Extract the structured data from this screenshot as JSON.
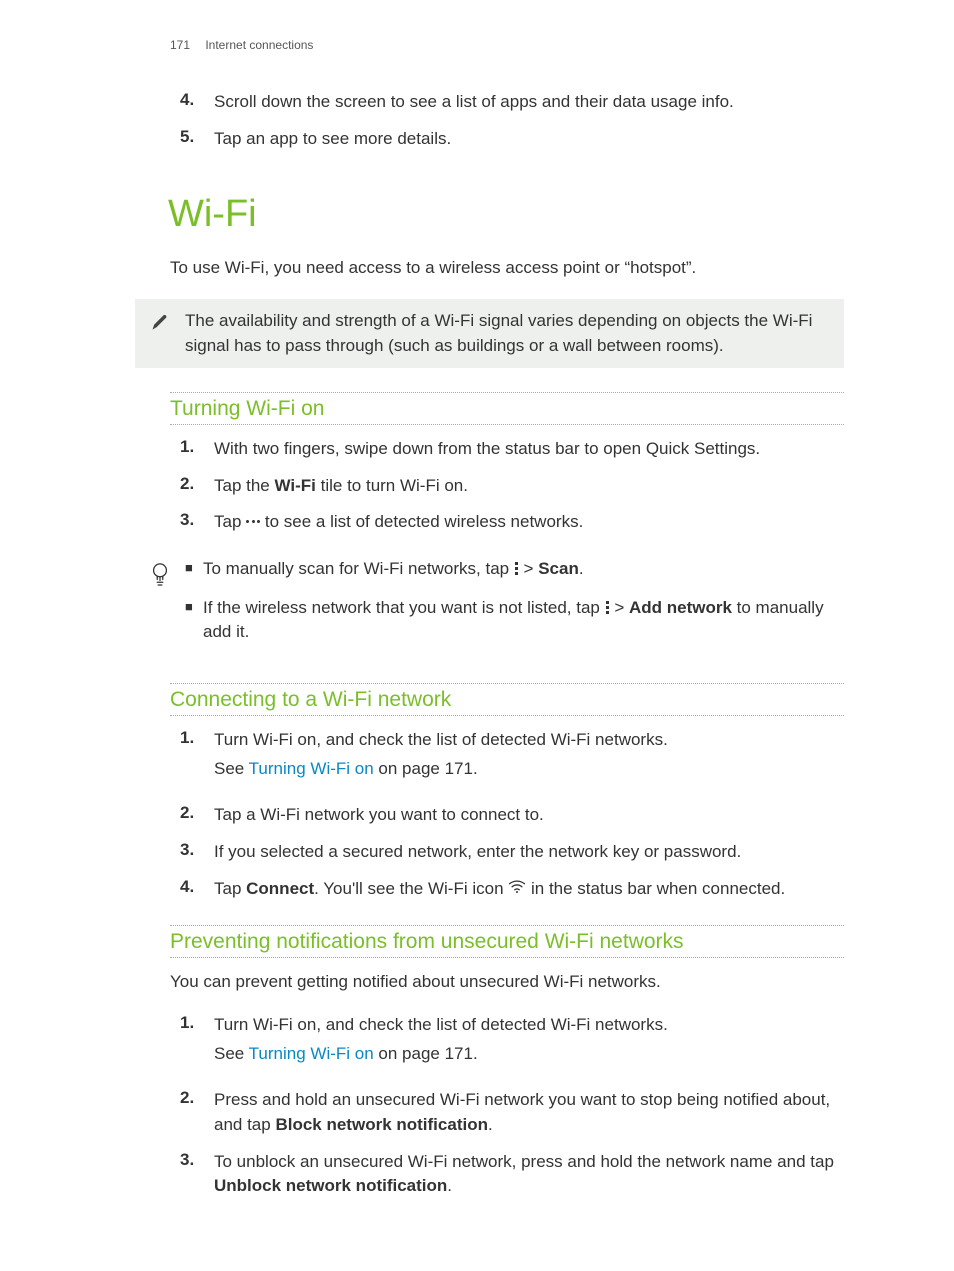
{
  "header": {
    "page": "171",
    "section": "Internet connections"
  },
  "intro_steps": [
    {
      "n": "4.",
      "t": "Scroll down the screen to see a list of apps and their data usage info."
    },
    {
      "n": "5.",
      "t": "Tap an app to see more details."
    }
  ],
  "h1": "Wi-Fi",
  "lead": "To use Wi-Fi, you need access to a wireless access point or “hotspot”.",
  "note1": "The availability and strength of a Wi-Fi signal varies depending on objects the Wi-Fi signal has to pass through (such as buildings or a wall between rooms).",
  "sec1": {
    "title": "Turning Wi-Fi on",
    "steps": {
      "s1": {
        "n": "1.",
        "t": "With two fingers, swipe down from the status bar to open Quick Settings."
      },
      "s2": {
        "n": "2.",
        "pre": "Tap the ",
        "bold": "Wi-Fi",
        "post": " tile to turn Wi-Fi on."
      },
      "s3": {
        "n": "3.",
        "pre": "Tap ",
        "post": " to see a list of detected wireless networks."
      }
    }
  },
  "tip1": {
    "b1": {
      "pre": "To manually scan for Wi-Fi networks, tap ",
      "mid": " > ",
      "bold": "Scan",
      "post": "."
    },
    "b2": {
      "pre": "If the wireless network that you want is not listed, tap ",
      "mid": " > ",
      "bold": "Add network",
      "post": " to manually add it."
    }
  },
  "sec2": {
    "title": "Connecting to a Wi-Fi network",
    "s1": {
      "n": "1.",
      "t": "Turn Wi-Fi on, and check the list of detected Wi-Fi networks.",
      "sub_pre": "See ",
      "sub_link": "Turning Wi-Fi on",
      "sub_post": " on page 171."
    },
    "s2": {
      "n": "2.",
      "t": "Tap a Wi-Fi network you want to connect to."
    },
    "s3": {
      "n": "3.",
      "t": "If you selected a secured network, enter the network key or password."
    },
    "s4": {
      "n": "4.",
      "pre": "Tap ",
      "bold": "Connect",
      "mid": ". You'll see the Wi-Fi icon ",
      "post": " in the status bar when connected."
    }
  },
  "sec3": {
    "title": "Preventing notifications from unsecured Wi-Fi networks",
    "intro": "You can prevent getting notified about unsecured Wi-Fi networks.",
    "s1": {
      "n": "1.",
      "t": "Turn Wi-Fi on, and check the list of detected Wi-Fi networks.",
      "sub_pre": "See ",
      "sub_link": "Turning Wi-Fi on",
      "sub_post": " on page 171."
    },
    "s2": {
      "n": "2.",
      "pre": "Press and hold an unsecured Wi-Fi network you want to stop being notified about, and tap ",
      "bold": "Block network notification",
      "post": "."
    },
    "s3": {
      "n": "3.",
      "pre": "To unblock an unsecured Wi-Fi network, press and hold the network name and tap ",
      "bold": "Unblock network notification",
      "post": "."
    }
  }
}
